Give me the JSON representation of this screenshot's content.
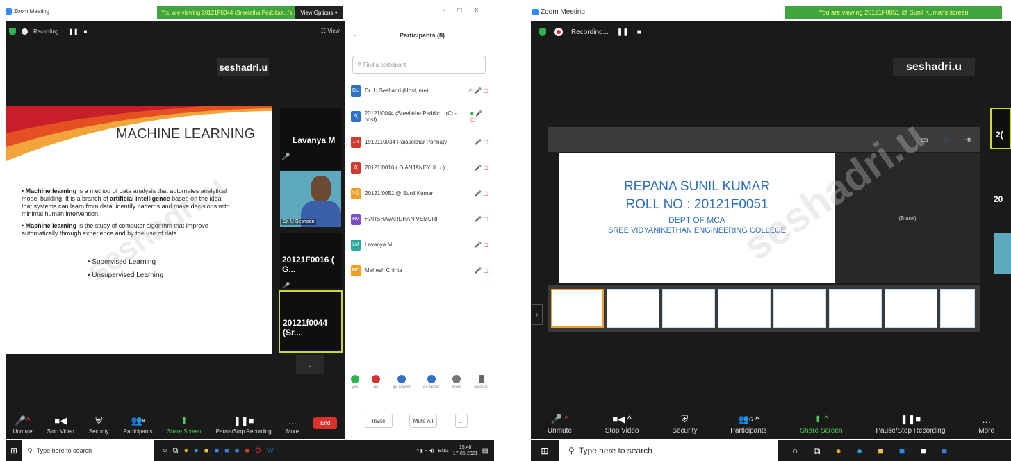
{
  "left": {
    "title": "Zoom Meeting",
    "banner": "You are viewing 20121F0044 (Sreelatha Peddibot...'s screen",
    "view_options": "View Options",
    "recording": "Recording...",
    "view_label": "View",
    "name_badge": "seshadri.u",
    "slide": {
      "title": "MACHINE LEARNING",
      "bullet1_bold": "Machine learning",
      "bullet1_a": " is a method of data analysis that automates analytical model building. It is a branch of ",
      "bullet1_bold2": "artificial intelligence",
      "bullet1_b": " based on the idea that systems can learn from data, identify patterns and make decisions with minimal human intervention.",
      "bullet2_bold": "Machine learning",
      "bullet2_a": " is the study of computer algorithm that improve automatically through experience and by the use of data.",
      "sub1": "Supervised Learning",
      "sub2": "Unsupervised Learning"
    },
    "tiles": {
      "t1": "Lavanya M",
      "t2_caption": "Dr. U Seshadri",
      "t3": "20121F0016 ( G...",
      "t4": "20121f0044 (Sr..."
    },
    "toolbar": [
      "Unmute",
      "Stop Video",
      "Security",
      "Participants",
      "Share Screen",
      "Pause/Stop Recording",
      "More"
    ],
    "participants_count": "8",
    "end": "End"
  },
  "participants": {
    "title": "Participants (8)",
    "window_controls": [
      "-",
      "□",
      "X"
    ],
    "search_placeholder": "Find a participant",
    "rows": [
      {
        "initials": "DU",
        "name": "Dr. U Seshadri (Host, me)",
        "color": "#2d6fc9"
      },
      {
        "initials": "2(",
        "name": "20121f0044 (Sreelatha Peddic... (Co-host)",
        "color": "#2d6fc9"
      },
      {
        "initials": "1R",
        "name": "1912110034 Rajasekhar Ponnaty",
        "color": "#d03b2e"
      },
      {
        "initials": "2(",
        "name": "20121f0016 ( G ANJANEYULU )",
        "color": "#d03b2e"
      },
      {
        "initials": "2@",
        "name": "20121f0051 @ Sunil Kumar",
        "color": "#f0a020"
      },
      {
        "initials": "HV",
        "name": "HARSHAVARDHAN VEMURI",
        "color": "#7a4fc9"
      },
      {
        "initials": "LM",
        "name": "Lavanya M",
        "color": "#2aa89a"
      },
      {
        "initials": "MC",
        "name": "Mahesh Chinta",
        "color": "#f0a020"
      }
    ],
    "reactions": [
      "yes",
      "no",
      "go slower",
      "go faster",
      "more",
      "clear all"
    ],
    "invite": "Invite",
    "mute_all": "Mute All",
    "more": "..."
  },
  "right": {
    "title": "Zoom Meeting",
    "banner": "You are viewing 20121F0051 @ Sunil Kumar's screen",
    "recording": "Recording...",
    "name_badge": "seshadri.u",
    "slide": {
      "line1": "REPANA SUNIL KUMAR",
      "line2": "ROLL NO : 20121F0051",
      "line3": "DEPT OF MCA",
      "line4": "SREE VIDYANIKETHAN ENGINEERING COLLEGE"
    },
    "blank": "(Blank)",
    "toolbar": [
      "Unmute",
      "Stop Video",
      "Security",
      "Participants",
      "Share Screen",
      "Pause/Stop Recording",
      "More"
    ],
    "participants_count": "6",
    "side_tile_a": "2(",
    "side_tile_b": "20"
  },
  "taskbar": {
    "search_placeholder": "Type here to search",
    "time": "15:48",
    "date": "17-05-2021",
    "lang": "ENG"
  }
}
